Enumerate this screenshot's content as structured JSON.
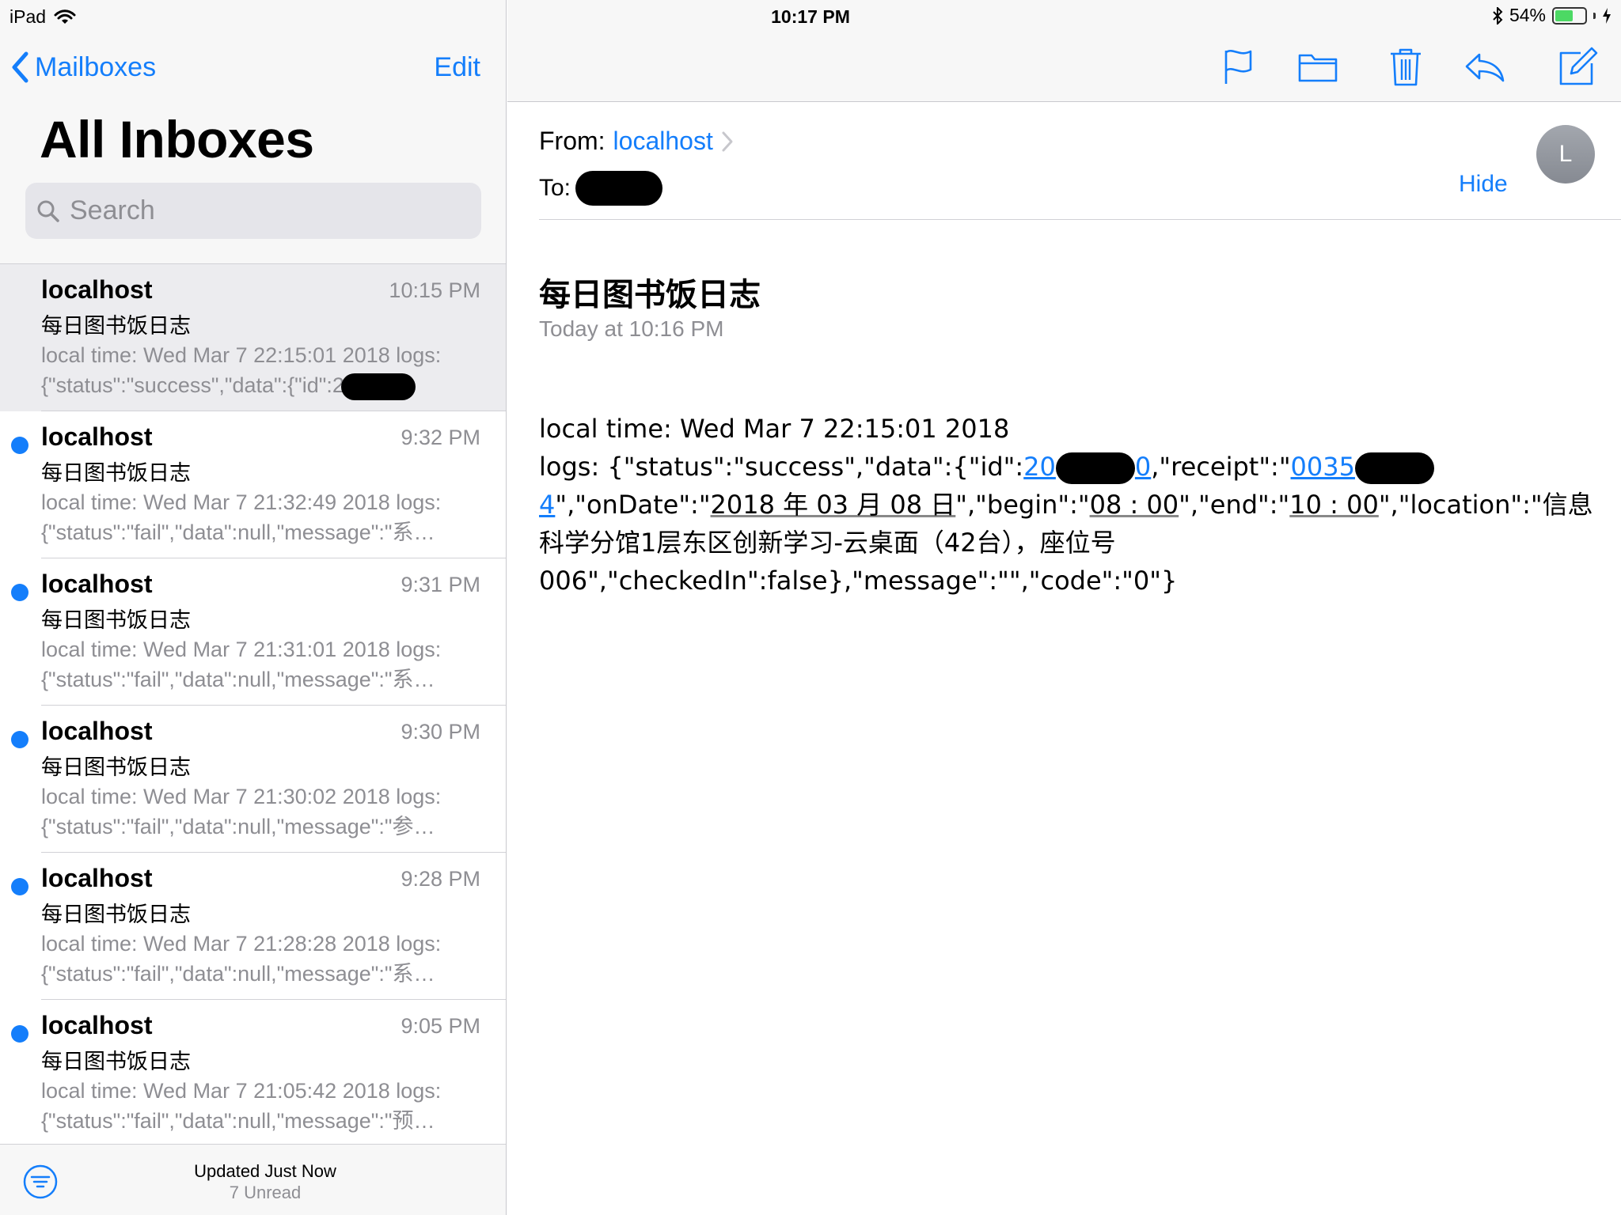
{
  "status_bar": {
    "device": "iPad",
    "time": "10:17 PM",
    "battery_percent": "54%",
    "battery_level": 0.54
  },
  "sidebar": {
    "back_label": "Mailboxes",
    "edit_label": "Edit",
    "title": "All Inboxes",
    "search_placeholder": "Search",
    "messages": [
      {
        "from": "localhost",
        "time": "10:15 PM",
        "subject": "每日图书饭日志",
        "preview_line1": "local time: Wed Mar 7 22:15:01 2018 logs:",
        "preview_line2": "{\"status\":\"success\",\"data\":{\"id\":2",
        "unread": false,
        "selected": true
      },
      {
        "from": "localhost",
        "time": "9:32 PM",
        "subject": "每日图书饭日志",
        "preview_line1": "local time: Wed Mar 7 21:32:49 2018 logs:",
        "preview_line2": "{\"status\":\"fail\",\"data\":null,\"message\":\"系…",
        "unread": true,
        "selected": false
      },
      {
        "from": "localhost",
        "time": "9:31 PM",
        "subject": "每日图书饭日志",
        "preview_line1": "local time: Wed Mar 7 21:31:01 2018 logs:",
        "preview_line2": "{\"status\":\"fail\",\"data\":null,\"message\":\"系…",
        "unread": true,
        "selected": false
      },
      {
        "from": "localhost",
        "time": "9:30 PM",
        "subject": "每日图书饭日志",
        "preview_line1": "local time: Wed Mar 7 21:30:02 2018 logs:",
        "preview_line2": "{\"status\":\"fail\",\"data\":null,\"message\":\"参…",
        "unread": true,
        "selected": false
      },
      {
        "from": "localhost",
        "time": "9:28 PM",
        "subject": "每日图书饭日志",
        "preview_line1": "local time: Wed Mar 7 21:28:28 2018 logs:",
        "preview_line2": "{\"status\":\"fail\",\"data\":null,\"message\":\"系…",
        "unread": true,
        "selected": false
      },
      {
        "from": "localhost",
        "time": "9:05 PM",
        "subject": "每日图书饭日志",
        "preview_line1": "local time: Wed Mar 7 21:05:42 2018 logs:",
        "preview_line2": "{\"status\":\"fail\",\"data\":null,\"message\":\"预…",
        "unread": true,
        "selected": false
      }
    ],
    "footer": {
      "updated": "Updated Just Now",
      "unread": "7 Unread"
    }
  },
  "toolbar": {
    "icons": [
      "flag-icon",
      "folder-icon",
      "trash-icon",
      "reply-icon",
      "compose-icon"
    ]
  },
  "message": {
    "from_label": "From:",
    "from_name": "localhost",
    "to_label": "To:",
    "avatar_initial": "L",
    "hide_label": "Hide",
    "subject": "每日图书饭日志",
    "date": "Today at 10:16 PM",
    "body_line1": "local time: Wed Mar  7 22:15:01 2018",
    "body_logs_prefix": "logs: {\"status\":\"success\",\"data\":{\"id\":",
    "body_id_visible": "20",
    "body_id_tail": "0",
    "body_receipt_prefix": ",\"receipt\":\"",
    "body_receipt_visible": "0035",
    "body_receipt_tail": "4",
    "body_ondate_prefix": "\",\"onDate\":\"",
    "body_ondate_value": "2018 年 03 月 08 日",
    "body_begin_prefix": "\",\"begin\":\"",
    "body_begin_value": "08 : 00",
    "body_end_prefix": "\",\"end\":\"",
    "body_end_value": "10 : 00",
    "body_rest": "\",\"location\":\"信息科学分馆1层东区创新学习-云桌面（42台），座位号006\",\"checkedIn\":false},\"message\":\"\",\"code\":\"0\"}"
  },
  "colors": {
    "accent": "#147efb",
    "secondary_text": "#8e8e93",
    "battery": "#4cd964"
  }
}
